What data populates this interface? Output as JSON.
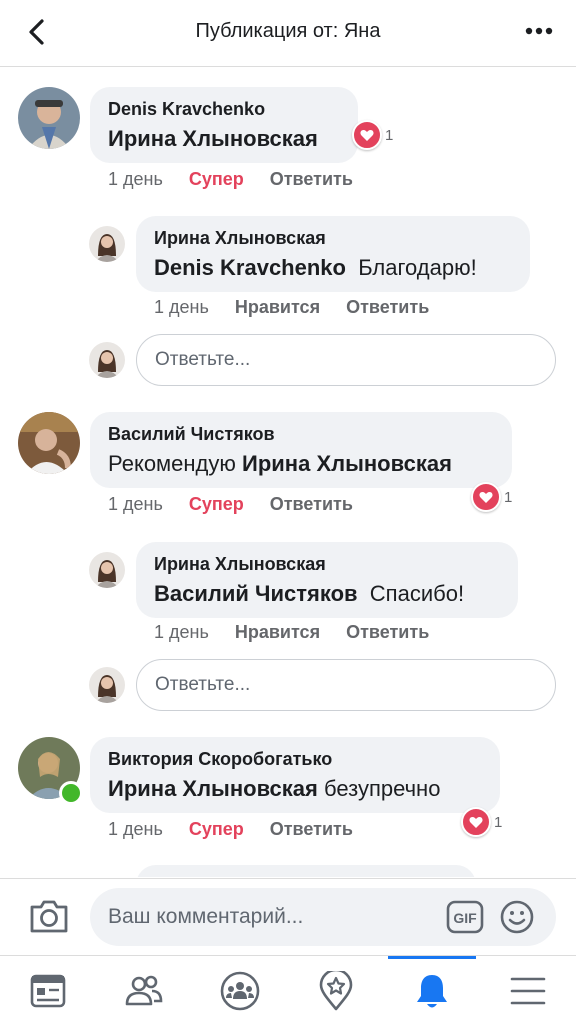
{
  "header": {
    "title": "Публикация от: Яна",
    "back_icon": "chevron-left-icon",
    "more_icon": "more-horizontal-icon"
  },
  "comments": [
    {
      "author": "Denis Kravchenko",
      "mention": "Ирина Хлыновская",
      "text": "",
      "time": "1 день",
      "reaction_label": "Супер",
      "reply_label": "Ответить",
      "reaction_count": "1",
      "reply": {
        "author": "Ирина Хлыновская",
        "mention": "Denis Kravchenko",
        "text": "Благодарю!",
        "time": "1 день",
        "like_label": "Нравится",
        "reply_label": "Ответить"
      },
      "reply_placeholder": "Ответьте..."
    },
    {
      "author": "Василий Чистяков",
      "prefix": "Рекомендую",
      "mention": "Ирина Хлыновская",
      "time": "1 день",
      "reaction_label": "Супер",
      "reply_label": "Ответить",
      "reaction_count": "1",
      "reply": {
        "author": "Ирина Хлыновская",
        "mention": "Василий Чистяков",
        "text": "Спасибо!",
        "time": "1 день",
        "like_label": "Нравится",
        "reply_label": "Ответить"
      },
      "reply_placeholder": "Ответьте..."
    },
    {
      "author": "Виктория Скоробогатько",
      "mention": "Ирина Хлыновская",
      "text": "безупречно",
      "time": "1 день",
      "reaction_label": "Супер",
      "reply_label": "Ответить",
      "reaction_count": "1"
    }
  ],
  "composer": {
    "placeholder": "Ваш комментарий...",
    "camera_icon": "camera-icon",
    "gif_label": "GIF",
    "emoji_icon": "smile-icon"
  },
  "tabbar": {
    "items": [
      "news-feed-icon",
      "friends-icon",
      "groups-icon",
      "pages-icon",
      "notifications-icon",
      "menu-icon"
    ],
    "active": "notifications-icon"
  },
  "colors": {
    "accent": "#1877f2",
    "super": "#e3425c",
    "online": "#42b72a"
  }
}
